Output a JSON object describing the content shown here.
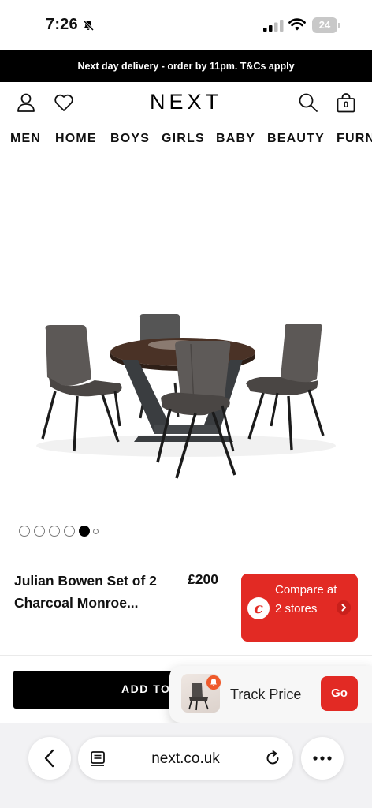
{
  "status_bar": {
    "time": "7:26",
    "battery": "24"
  },
  "promo": {
    "text": "Next day delivery - order by 11pm. T&Cs apply"
  },
  "header": {
    "logo": "NEXT",
    "bag_count": "0"
  },
  "categories": [
    "MEN",
    "HOME",
    "BOYS",
    "GIRLS",
    "BABY",
    "BEAUTY",
    "FURN"
  ],
  "product": {
    "title": "Julian Bowen Set of 2 Charcoal Monroe...",
    "price": "£200",
    "carousel": {
      "count": 6,
      "active_index": 4
    }
  },
  "compare": {
    "logo_letter": "c",
    "text": "Compare at 2 stores"
  },
  "sticky": {
    "add_to_bag_label": "ADD TO BAG"
  },
  "track_price": {
    "label": "Track Price",
    "go_label": "Go"
  },
  "browser": {
    "url": "next.co.uk"
  },
  "colors": {
    "brand_black": "#000000",
    "accent_red": "#e22a24"
  }
}
